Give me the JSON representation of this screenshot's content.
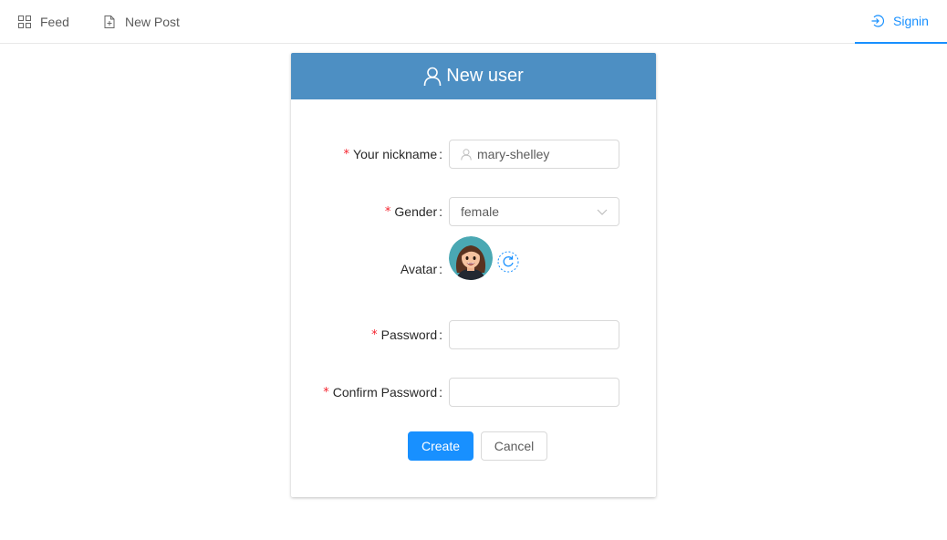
{
  "nav": {
    "feed_label": "Feed",
    "newpost_label": "New Post",
    "signin_label": "Signin"
  },
  "form": {
    "title": "New user",
    "required_mark": "*",
    "nickname": {
      "label": "Your nickname",
      "value": "mary-shelley"
    },
    "gender": {
      "label": "Gender",
      "value": "female"
    },
    "avatar": {
      "label": "Avatar"
    },
    "password": {
      "label": "Password",
      "value": ""
    },
    "confirm_password": {
      "label": "Confirm Password",
      "value": ""
    },
    "colon": ":",
    "create_label": "Create",
    "cancel_label": "Cancel"
  },
  "colors": {
    "accent": "#1890ff",
    "header": "#4d8fc3",
    "required": "#f5222d"
  },
  "icons": [
    "appstore-icon",
    "file-add-icon",
    "login-icon",
    "user-icon",
    "lock-icon",
    "chevron-down-icon",
    "reload-icon"
  ]
}
